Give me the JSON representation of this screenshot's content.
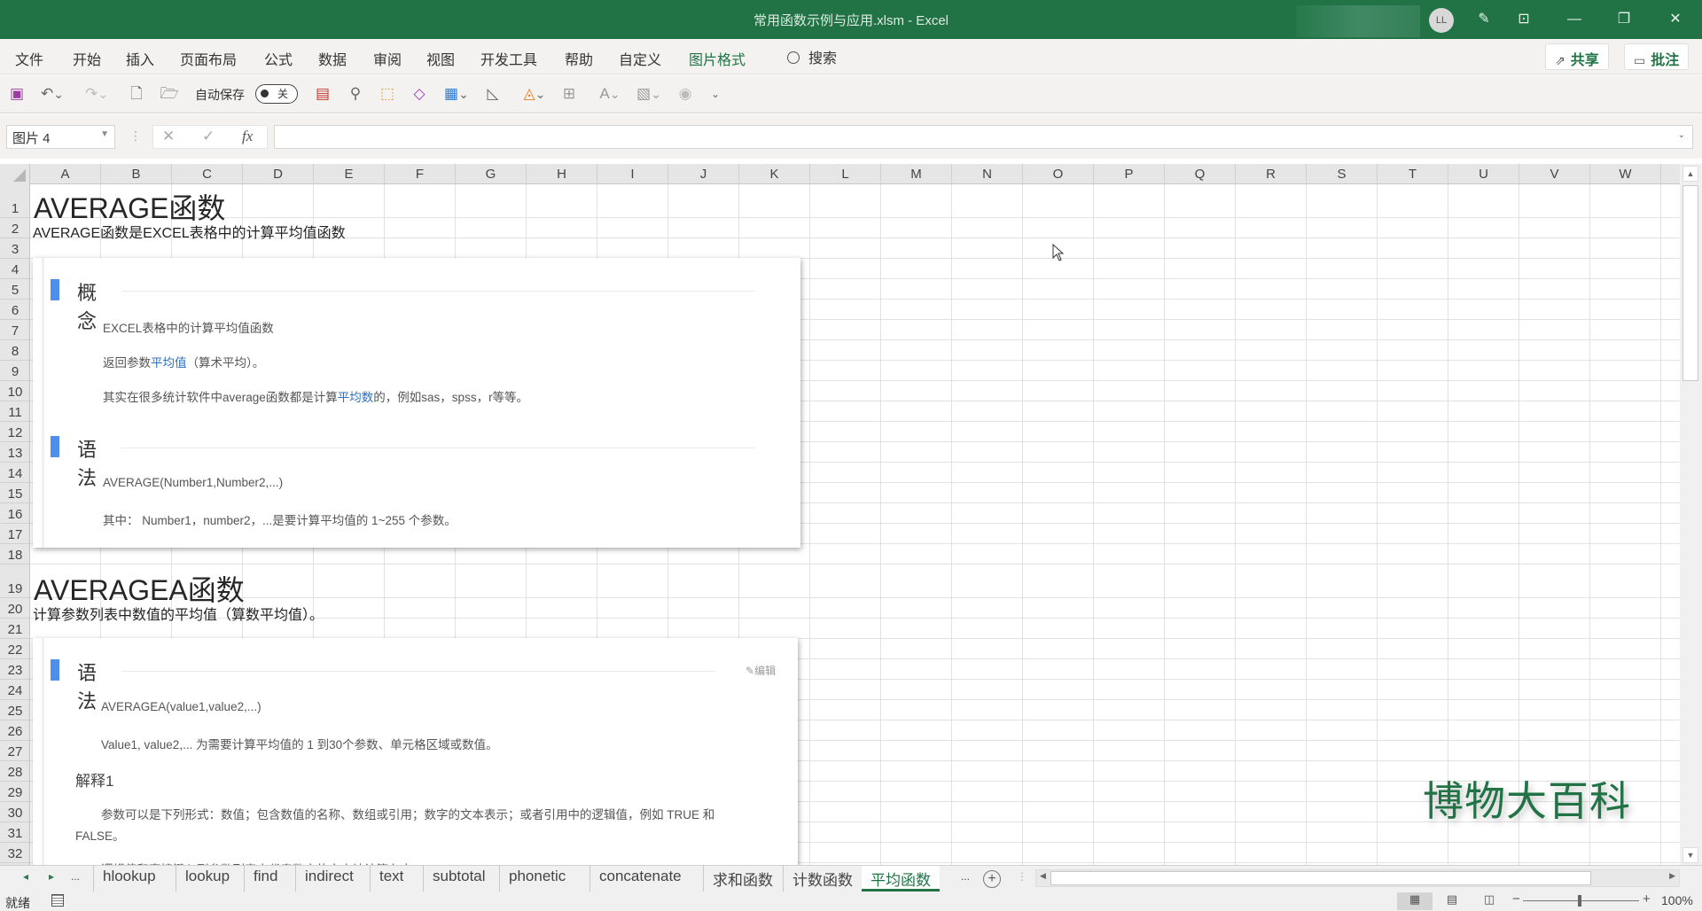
{
  "window": {
    "title": "常用函数示例与应用.xlsm  -  Excel",
    "user_initials": "LL",
    "controls": [
      "pen-icon",
      "ribbon-display-icon",
      "minimize",
      "restore",
      "close"
    ]
  },
  "menu": {
    "items": [
      "文件",
      "开始",
      "插入",
      "页面布局",
      "公式",
      "数据",
      "审阅",
      "视图",
      "开发工具",
      "帮助",
      "自定义",
      "图片格式"
    ],
    "active": "图片格式",
    "search_label": "搜索",
    "share_label": "共享",
    "comments_label": "批注"
  },
  "quick_access": {
    "autosave_label": "自动保存",
    "autosave_state": "关",
    "icons": [
      "save-icon",
      "undo-icon",
      "redo-icon",
      "new-file-icon",
      "open-folder-icon",
      "form-icon",
      "find-icon",
      "select-object-icon",
      "eraser-icon",
      "insert-table-icon",
      "ruler-icon",
      "fill-color-icon",
      "borders-icon",
      "font-color-icon",
      "format-painter-icon",
      "circle-icon",
      "customize-qat-icon"
    ]
  },
  "formula_bar": {
    "name_box": "图片 4",
    "cancel": "✕",
    "enter": "✓",
    "fx": "fx",
    "formula": ""
  },
  "sheet": {
    "columns": [
      "A",
      "B",
      "C",
      "D",
      "E",
      "F",
      "G",
      "H",
      "I",
      "J",
      "K",
      "L",
      "M",
      "N",
      "O",
      "P",
      "Q",
      "R",
      "S",
      "T",
      "U",
      "V",
      "W"
    ],
    "rows": [
      "1",
      "2",
      "3",
      "4",
      "5",
      "6",
      "7",
      "8",
      "9",
      "10",
      "11",
      "12",
      "13",
      "14",
      "15",
      "16",
      "17",
      "18",
      "19",
      "20",
      "21",
      "22",
      "23",
      "24",
      "25",
      "26",
      "27",
      "28",
      "29",
      "30",
      "31",
      "32"
    ],
    "cells": {
      "A1": "AVERAGE函数",
      "A2": "AVERAGE函数是EXCEL表格中的计算平均值函数",
      "A19": "AVERAGEA函数",
      "A20": "计算参数列表中数值的平均值（算数平均值）。"
    }
  },
  "picture1": {
    "sections": [
      {
        "heading": "概念",
        "paragraphs": [
          {
            "pre": "EXCEL表格中的计算平均值函数",
            "link": "",
            "post": ""
          },
          {
            "pre": "返回参数",
            "link": "平均值",
            "post": "（算术平均）。"
          },
          {
            "pre": "其实在很多统计软件中average函数都是计算",
            "link": "平均数",
            "post": "的，例如sas，spss，r等等。"
          }
        ]
      },
      {
        "heading": "语法",
        "paragraphs": [
          {
            "pre": "AVERAGE(Number1,Number2,...)",
            "link": "",
            "post": ""
          },
          {
            "pre": "其中：   Number1，number2，...是要计算平均值的 1~255 个参数。",
            "link": "",
            "post": ""
          }
        ]
      }
    ]
  },
  "picture2": {
    "heading": "语法",
    "edit_label": "编辑",
    "syntax": "AVERAGEA(value1,value2,...)",
    "desc": "Value1, value2,... 为需要计算平均值的 1 到30个参数、单元格区域或数值。",
    "subheading": "解释1",
    "explain_line1": "参数可以是下列形式：数值；包含数值的名称、数组或引用；数字的文本表示；或者引用中的逻辑值，例如 TRUE 和",
    "explain_line2": "FALSE。",
    "explain_line3": "逻辑值和直接键入到参数列表中代表数字的文本被计算在内。"
  },
  "watermark": "博物大百科",
  "sheet_tabs": {
    "nav_prev": "◂",
    "nav_next": "▸",
    "overflow": "...",
    "tabs": [
      "hlookup",
      "lookup",
      "find",
      "indirect",
      "text",
      "subtotal",
      "phonetic",
      "concatenate",
      "求和函数",
      "计数函数",
      "平均函数"
    ],
    "active": "平均函数",
    "add": "+"
  },
  "status_bar": {
    "ready": "就绪",
    "zoom": "100%",
    "zoom_minus": "−",
    "zoom_plus": "+"
  },
  "colors": {
    "brand": "#217346",
    "section_bar": "#4f8fea",
    "link": "#2b6fc1"
  }
}
